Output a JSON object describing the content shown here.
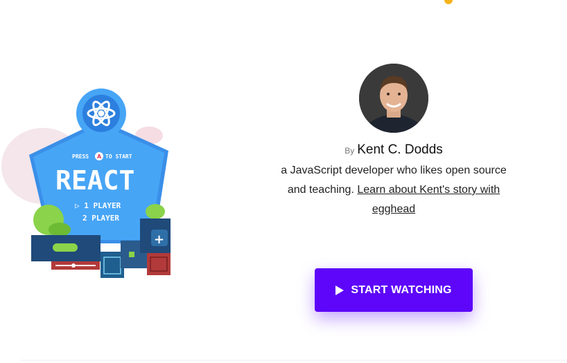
{
  "course_art": {
    "title_text": "REACT",
    "press_text": "PRESS",
    "start_text": "TO START",
    "button_letter": "A",
    "player_one": "▷ 1 PLAYER",
    "player_two": "2 PLAYER",
    "icon": "react-atom-icon"
  },
  "author": {
    "by_label": "By",
    "name": "Kent C. Dodds",
    "bio_text": "a JavaScript developer who likes open source and teaching. ",
    "bio_link": "Learn about Kent's story with egghead"
  },
  "cta": {
    "label": "START WATCHING",
    "icon": "play-icon",
    "color": "#5d06f9"
  },
  "colors": {
    "accent": "#5d06f9",
    "badge_blue": "#2f9cf4",
    "cabinet_navy": "#1f4a7a",
    "leaf_green": "#8bd34a"
  }
}
